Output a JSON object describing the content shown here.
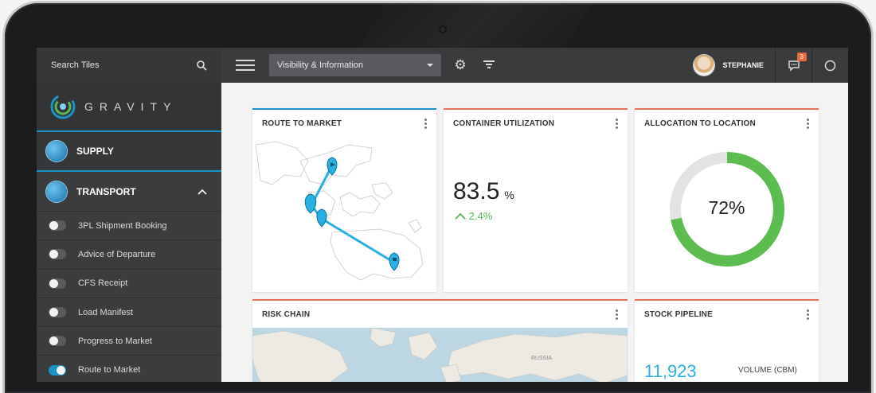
{
  "sidebar": {
    "search_placeholder": "Search Tiles",
    "logo_text": "GRAVITY",
    "sections": [
      {
        "label": "SUPPLY"
      },
      {
        "label": "TRANSPORT"
      }
    ],
    "items": [
      {
        "label": "3PL Shipment Booking",
        "on": false
      },
      {
        "label": "Advice of Departure",
        "on": false
      },
      {
        "label": "CFS Receipt",
        "on": false
      },
      {
        "label": "Load Manifest",
        "on": false
      },
      {
        "label": "Progress to Market",
        "on": false
      },
      {
        "label": "Route to Market",
        "on": true
      }
    ]
  },
  "topbar": {
    "dropdown_value": "Visibility & Information",
    "username": "STEPHANIE",
    "notification_count": "3"
  },
  "tiles": {
    "route": {
      "title": "ROUTE TO MARKET"
    },
    "container": {
      "title": "CONTAINER UTILIZATION",
      "value": "83.5",
      "unit": "%",
      "delta": "2.4%"
    },
    "allocation": {
      "title": "ALLOCATION TO LOCATION",
      "value": "72%",
      "fraction": 0.72
    },
    "risk": {
      "title": "RISK CHAIN"
    },
    "stock": {
      "title": "STOCK PIPELINE",
      "value": "11,923",
      "unit": "VOLUME  (CBM)"
    }
  },
  "colors": {
    "accent": "#1c93c7",
    "green": "#5ab853",
    "red": "#e8745f"
  }
}
